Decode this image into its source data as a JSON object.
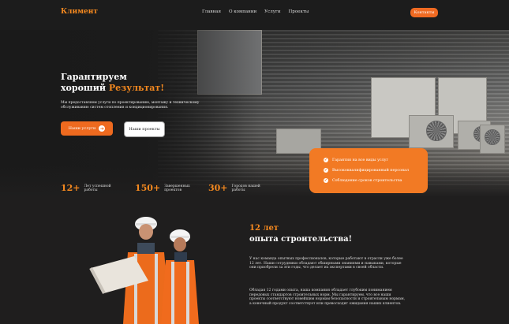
{
  "header": {
    "logo": "Климент",
    "nav": [
      "Главная",
      "О компании",
      "Услуги",
      "Проекты"
    ],
    "contact_button": "Контакты"
  },
  "hero": {
    "title_line1": "Гарантируем",
    "title_line2_prefix": "хороший ",
    "title_line2_accent": "Результат!",
    "description": "Мы предоставляем услуги по проектированию, монтажу и техническому обслуживанию систем отопления и кондиционирования.",
    "primary_button": "Наши услуги",
    "secondary_button": "Наши проекты"
  },
  "features": [
    "Гарантия на все виды услуг",
    "Высококвалифицированный персонал",
    "Соблюдение сроков строительства"
  ],
  "stats": [
    {
      "number": "12+",
      "label": "Лет успешной работы"
    },
    {
      "number": "150+",
      "label": "Завершенных проектов"
    },
    {
      "number": "30+",
      "label": "Городов нашей работы"
    }
  ],
  "about": {
    "title_line1": "12 лет",
    "title_line2": "опыта строительства!",
    "paragraph1": "У нас команда опытных профессионалов, которые работают в отрасли уже более 12 лет. Наши сотрудники обладают обширными знаниями и навыками, которые они приобрели за эти годы, что делает их экспертами в своей области.",
    "paragraph2": "Обладая 12 годами опыта, наша компания обладает глубоким пониманием передовых стандартов строительных норм. Мы гарантируем, что все наши проекты соответствуют новейшим нормам безопасности и строительным нормам, а конечный продукт соответствует или превосходит ожидания наших клиентов."
  },
  "colors": {
    "accent": "#f5891f",
    "button": "#ee6a1f",
    "background": "#1f1e1e"
  }
}
